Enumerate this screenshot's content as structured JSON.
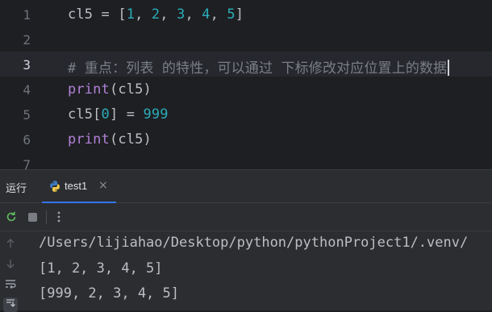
{
  "editor": {
    "line_numbers": [
      "1",
      "2",
      "3",
      "4",
      "5",
      "6",
      "7"
    ],
    "lines": {
      "l1": {
        "var": "cl5",
        "eq": " = ",
        "open": "[",
        "n1": "1",
        "c1": ", ",
        "n2": "2",
        "c2": ", ",
        "n3": "3",
        "c3": ", ",
        "n4": "4",
        "c4": ", ",
        "n5": "5",
        "close": "]"
      },
      "l3": {
        "comment": "# 重点：列表 的特性，可以通过 下标修改对应位置上的数据"
      },
      "l4": {
        "fn": "print",
        "args": "(cl5)"
      },
      "l5": {
        "var": "cl5",
        "open": "[",
        "idx": "0",
        "close": "]",
        "eq": " = ",
        "val": "999"
      },
      "l6": {
        "fn": "print",
        "args": "(cl5)"
      }
    }
  },
  "run_panel": {
    "title": "运行",
    "tab_label": "test1",
    "tab_close": "×",
    "tab_icon": "python-icon",
    "accent": "#3574f0"
  },
  "console": {
    "lines": [
      "/Users/lijiahao/Desktop/python/pythonProject1/.venv/",
      "[1, 2, 3, 4, 5]",
      "[999, 2, 3, 4, 5]"
    ]
  },
  "colors": {
    "background": "#1e1f22",
    "number": "#2aacb8",
    "keyword_function": "#b180d7",
    "comment": "#7a7e85",
    "text": "#bcbec4"
  }
}
